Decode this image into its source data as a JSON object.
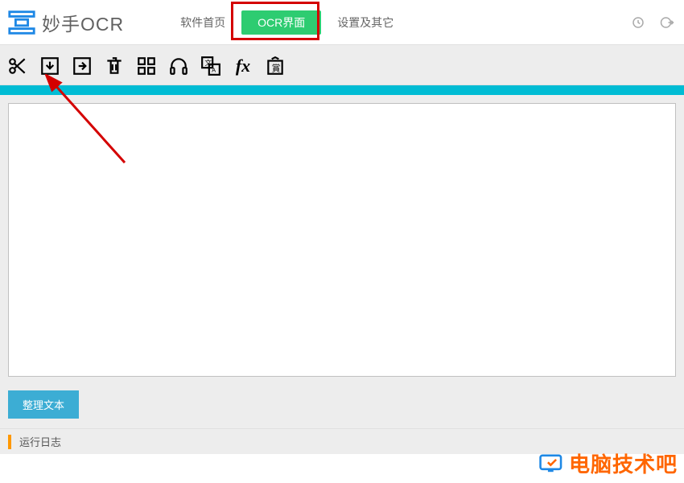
{
  "header": {
    "app_name": "妙手OCR",
    "nav": {
      "home": "软件首页",
      "ocr": "OCR界面",
      "settings": "设置及其它"
    }
  },
  "toolbar": {
    "icons": {
      "scissors": "scissors-icon",
      "import": "import-icon",
      "export": "export-icon",
      "delete": "delete-icon",
      "qr": "qr-icon",
      "headphones": "headphones-icon",
      "translate": "translate-icon",
      "fx": "fx",
      "reward": "reward-icon"
    }
  },
  "main": {
    "text_content": "",
    "organize_btn": "整理文本"
  },
  "log": {
    "label": "运行日志"
  },
  "watermark": {
    "text": "电脑技术吧"
  },
  "colors": {
    "accent_green": "#2ecc71",
    "accent_cyan": "#00bcd4",
    "accent_blue": "#3cadd4",
    "accent_orange": "#ff9800",
    "highlight_red": "#d40000",
    "watermark_orange": "#ff6600"
  }
}
